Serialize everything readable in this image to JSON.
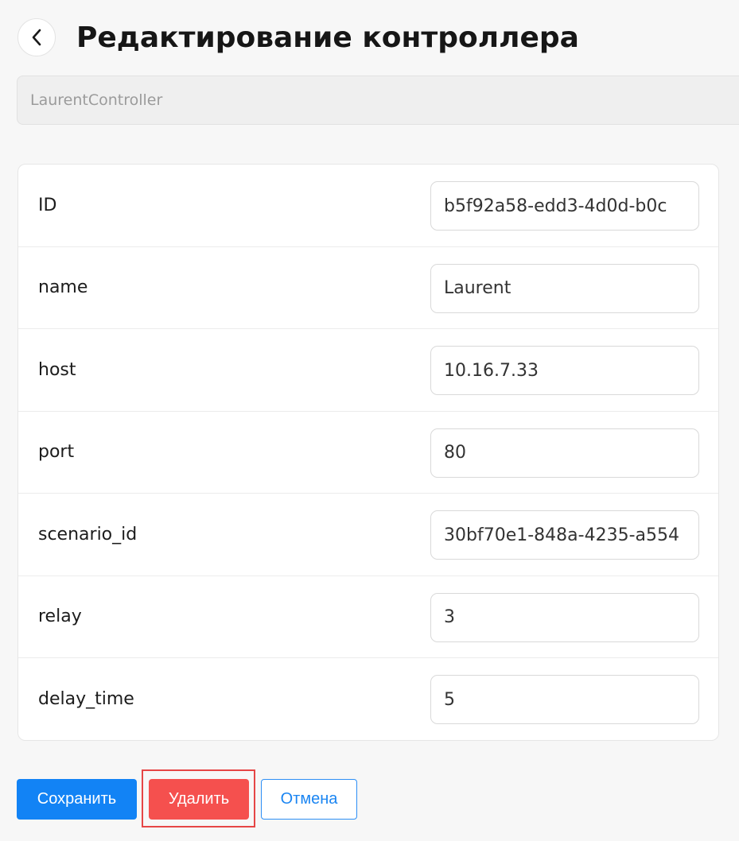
{
  "header": {
    "title": "Редактирование контроллера",
    "back_icon": "chevron-left-icon"
  },
  "controller_type": {
    "value": "LaurentController"
  },
  "fields": [
    {
      "label": "ID",
      "value": "b5f92a58-edd3-4d0d-b0c"
    },
    {
      "label": "name",
      "value": "Laurent"
    },
    {
      "label": "host",
      "value": "10.16.7.33"
    },
    {
      "label": "port",
      "value": "80"
    },
    {
      "label": "scenario_id",
      "value": "30bf70e1-848a-4235-a554"
    },
    {
      "label": "relay",
      "value": "3"
    },
    {
      "label": "delay_time",
      "value": "5"
    }
  ],
  "actions": {
    "save_label": "Сохранить",
    "delete_label": "Удалить",
    "cancel_label": "Отмена"
  },
  "colors": {
    "primary": "#1283f5",
    "danger": "#f5504e",
    "highlight": "#e64646",
    "background": "#f7f7f7"
  }
}
